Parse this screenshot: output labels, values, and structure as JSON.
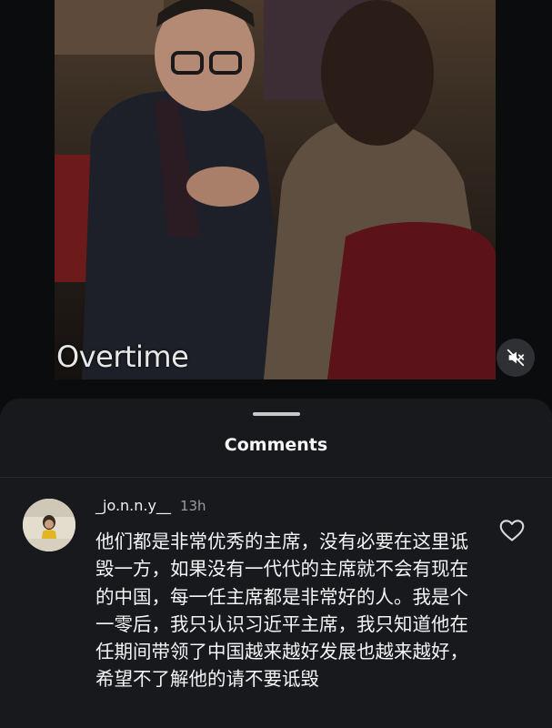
{
  "video": {
    "watermark": "Overtime",
    "mute_icon": "muted-speaker-icon"
  },
  "comments_sheet": {
    "title": "Comments",
    "comments": [
      {
        "username": "_jo.n.n.y__",
        "time": "13h",
        "text": "他们都是非常优秀的主席，没有必要在这里诋毁一方，如果没有一代代的主席就不会有现在的中国，每一任主席都是非常好的人。我是个一零后，我只认识习近平主席，我只知道他在任期间带领了中国越来越好发展也越来越好，希望不了解他的请不要诋毁",
        "like_icon": "heart-icon"
      }
    ]
  },
  "colors": {
    "background": "#0b0c0e",
    "sheet": "#17191d",
    "text": "#f4f4f4",
    "muted_text": "#9a9ca3"
  }
}
